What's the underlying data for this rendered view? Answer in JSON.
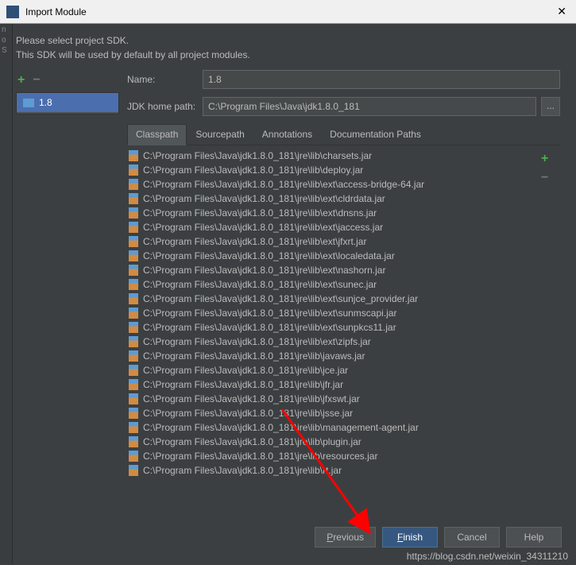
{
  "window": {
    "title": "Import Module"
  },
  "instructions": {
    "line1": "Please select project SDK.",
    "line2": "This SDK will be used by default by all project modules."
  },
  "sidebar": {
    "selected_sdk": "1.8"
  },
  "form": {
    "name_label": "Name:",
    "name_value": "1.8",
    "home_label": "JDK home path:",
    "home_value": "C:\\Program Files\\Java\\jdk1.8.0_181"
  },
  "tabs": {
    "items": [
      {
        "label": "Classpath",
        "active": true
      },
      {
        "label": "Sourcepath",
        "active": false
      },
      {
        "label": "Annotations",
        "active": false
      },
      {
        "label": "Documentation Paths",
        "active": false
      }
    ]
  },
  "classpath": {
    "files": [
      "C:\\Program Files\\Java\\jdk1.8.0_181\\jre\\lib\\charsets.jar",
      "C:\\Program Files\\Java\\jdk1.8.0_181\\jre\\lib\\deploy.jar",
      "C:\\Program Files\\Java\\jdk1.8.0_181\\jre\\lib\\ext\\access-bridge-64.jar",
      "C:\\Program Files\\Java\\jdk1.8.0_181\\jre\\lib\\ext\\cldrdata.jar",
      "C:\\Program Files\\Java\\jdk1.8.0_181\\jre\\lib\\ext\\dnsns.jar",
      "C:\\Program Files\\Java\\jdk1.8.0_181\\jre\\lib\\ext\\jaccess.jar",
      "C:\\Program Files\\Java\\jdk1.8.0_181\\jre\\lib\\ext\\jfxrt.jar",
      "C:\\Program Files\\Java\\jdk1.8.0_181\\jre\\lib\\ext\\localedata.jar",
      "C:\\Program Files\\Java\\jdk1.8.0_181\\jre\\lib\\ext\\nashorn.jar",
      "C:\\Program Files\\Java\\jdk1.8.0_181\\jre\\lib\\ext\\sunec.jar",
      "C:\\Program Files\\Java\\jdk1.8.0_181\\jre\\lib\\ext\\sunjce_provider.jar",
      "C:\\Program Files\\Java\\jdk1.8.0_181\\jre\\lib\\ext\\sunmscapi.jar",
      "C:\\Program Files\\Java\\jdk1.8.0_181\\jre\\lib\\ext\\sunpkcs11.jar",
      "C:\\Program Files\\Java\\jdk1.8.0_181\\jre\\lib\\ext\\zipfs.jar",
      "C:\\Program Files\\Java\\jdk1.8.0_181\\jre\\lib\\javaws.jar",
      "C:\\Program Files\\Java\\jdk1.8.0_181\\jre\\lib\\jce.jar",
      "C:\\Program Files\\Java\\jdk1.8.0_181\\jre\\lib\\jfr.jar",
      "C:\\Program Files\\Java\\jdk1.8.0_181\\jre\\lib\\jfxswt.jar",
      "C:\\Program Files\\Java\\jdk1.8.0_181\\jre\\lib\\jsse.jar",
      "C:\\Program Files\\Java\\jdk1.8.0_181\\jre\\lib\\management-agent.jar",
      "C:\\Program Files\\Java\\jdk1.8.0_181\\jre\\lib\\plugin.jar",
      "C:\\Program Files\\Java\\jdk1.8.0_181\\jre\\lib\\resources.jar",
      "C:\\Program Files\\Java\\jdk1.8.0_181\\jre\\lib\\rt.jar"
    ]
  },
  "buttons": {
    "previous": "Previous",
    "finish": "Finish",
    "cancel": "Cancel",
    "help": "Help"
  },
  "watermark": "https://blog.csdn.net/weixin_34311210"
}
